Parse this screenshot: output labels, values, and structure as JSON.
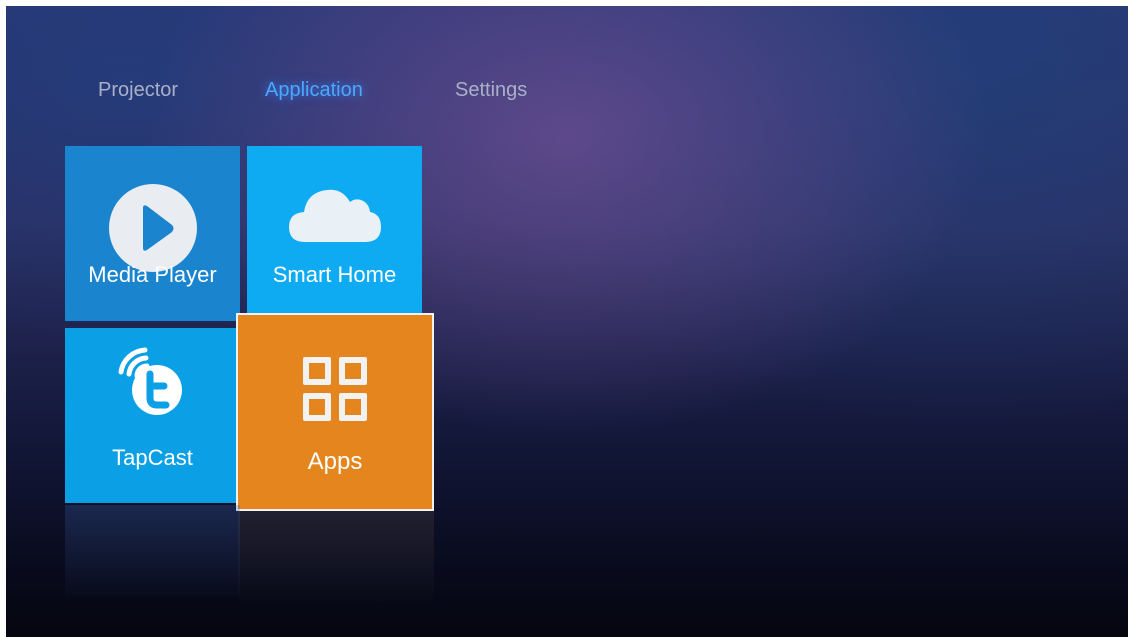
{
  "tabs": [
    {
      "label": "Projector",
      "selected": false
    },
    {
      "label": "Application",
      "selected": true
    },
    {
      "label": "Settings",
      "selected": false
    }
  ],
  "tiles": [
    {
      "label": "Media Player",
      "icon": "play-icon",
      "color": "#1b84cf"
    },
    {
      "label": "Smart Home",
      "icon": "cloud-icon",
      "color": "#0eabf3"
    },
    {
      "label": "TapCast",
      "icon": "tapcast-icon",
      "color": "#0ba0e5"
    },
    {
      "label": "Apps",
      "icon": "apps-grid-icon",
      "color": "#e4861d",
      "focused": true
    }
  ],
  "colors": {
    "selected_tab": "#4aa8ff",
    "unselected_tab": "#a9b0c9",
    "focus_border": "#f2f2f2"
  }
}
